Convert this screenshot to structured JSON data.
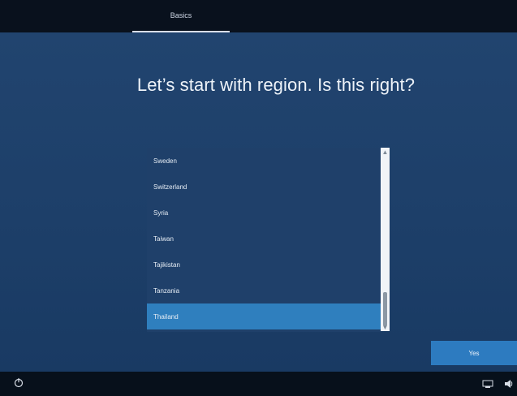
{
  "header": {
    "tab_label": "Basics"
  },
  "main": {
    "headline": "Let’s start with region. Is this right?",
    "regions": [
      "Sweden",
      "Switzerland",
      "Syria",
      "Taiwan",
      "Tajikistan",
      "Tanzania",
      "Thailand"
    ],
    "selected_region": "Thailand"
  },
  "footer": {
    "yes_label": "Yes"
  },
  "icons": {
    "accessibility": "accessibility-icon",
    "network": "network-icon",
    "volume": "volume-icon",
    "scroll_up": "chevron-up-icon",
    "scroll_down": "chevron-down-icon"
  },
  "colors": {
    "background": "#21446f",
    "selected": "#2f7fbe",
    "button": "#2d7bc0"
  }
}
